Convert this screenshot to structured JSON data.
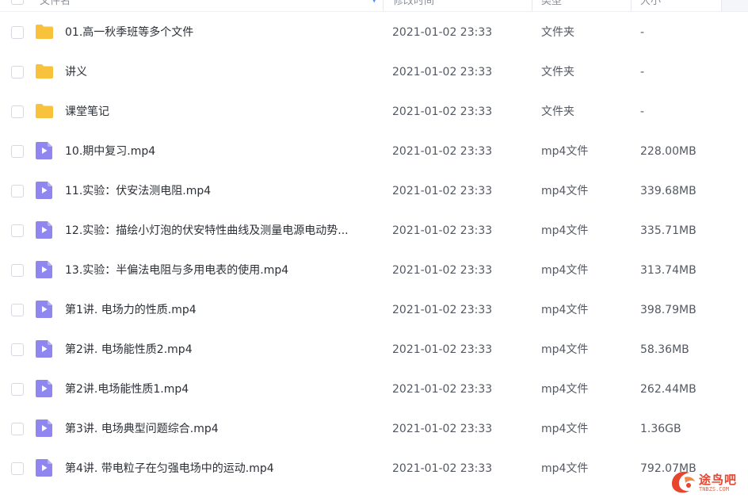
{
  "header": {
    "name_label": "文件名",
    "time_label": "修改时间",
    "type_label": "类型",
    "size_label": "大小"
  },
  "colors": {
    "folder": "#f9c23c",
    "video": "#8f86f0",
    "text_primary": "#2b2f36",
    "text_secondary": "#535862",
    "accent": "#4a8cf6",
    "watermark": "#e8452f"
  },
  "files": [
    {
      "icon": "folder-icon",
      "name": "01.高一秋季班等多个文件",
      "time": "2021-01-02 23:33",
      "type": "文件夹",
      "size": "-"
    },
    {
      "icon": "folder-icon",
      "name": "讲义",
      "time": "2021-01-02 23:33",
      "type": "文件夹",
      "size": "-"
    },
    {
      "icon": "folder-icon",
      "name": "课堂笔记",
      "time": "2021-01-02 23:33",
      "type": "文件夹",
      "size": "-"
    },
    {
      "icon": "video-file-icon",
      "name": "10.期中复习.mp4",
      "time": "2021-01-02 23:33",
      "type": "mp4文件",
      "size": "228.00MB"
    },
    {
      "icon": "video-file-icon",
      "name": "11.实验：伏安法测电阻.mp4",
      "time": "2021-01-02 23:33",
      "type": "mp4文件",
      "size": "339.68MB"
    },
    {
      "icon": "video-file-icon",
      "name": "12.实验：描绘小灯泡的伏安特性曲线及测量电源电动势...",
      "time": "2021-01-02 23:33",
      "type": "mp4文件",
      "size": "335.71MB"
    },
    {
      "icon": "video-file-icon",
      "name": "13.实验：半偏法电阻与多用电表的使用.mp4",
      "time": "2021-01-02 23:33",
      "type": "mp4文件",
      "size": "313.74MB"
    },
    {
      "icon": "video-file-icon",
      "name": "第1讲. 电场力的性质.mp4",
      "time": "2021-01-02 23:33",
      "type": "mp4文件",
      "size": "398.79MB"
    },
    {
      "icon": "video-file-icon",
      "name": "第2讲. 电场能性质2.mp4",
      "time": "2021-01-02 23:33",
      "type": "mp4文件",
      "size": "58.36MB"
    },
    {
      "icon": "video-file-icon",
      "name": "第2讲.电场能性质1.mp4",
      "time": "2021-01-02 23:33",
      "type": "mp4文件",
      "size": "262.44MB"
    },
    {
      "icon": "video-file-icon",
      "name": "第3讲. 电场典型问题综合.mp4",
      "time": "2021-01-02 23:33",
      "type": "mp4文件",
      "size": "1.36GB"
    },
    {
      "icon": "video-file-icon",
      "name": "第4讲. 带电粒子在匀强电场中的运动.mp4",
      "time": "2021-01-02 23:33",
      "type": "mp4文件",
      "size": "792.07MB"
    }
  ],
  "watermark": {
    "title": "途鸟吧",
    "subtitle": "TNBZS.COM"
  }
}
